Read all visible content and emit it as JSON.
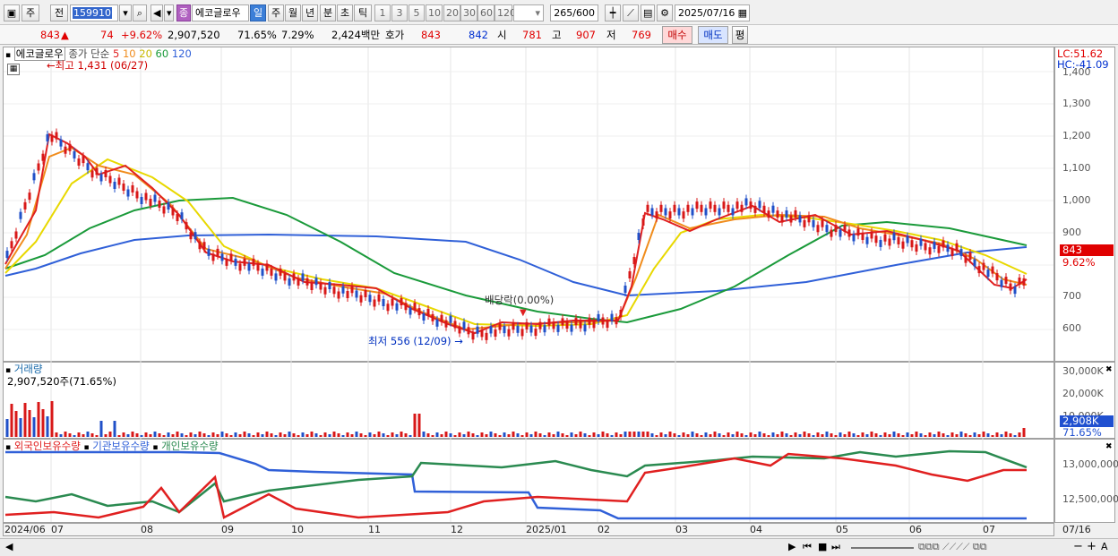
{
  "toolbar": {
    "period_label": "주",
    "prev_label": "전",
    "code": "159910",
    "stock_badge": "종",
    "stock_name": "에코글로우",
    "periods": [
      "일",
      "주",
      "월",
      "년",
      "분",
      "초",
      "틱"
    ],
    "selected_period": "일",
    "intervals": [
      "1",
      "3",
      "5",
      "10",
      "20",
      "30",
      "60",
      "120"
    ],
    "count_value": "265",
    "count_total": "/600",
    "date": "2025/07/16"
  },
  "quote": {
    "price": "843",
    "change": "74",
    "change_pct": "+9.62%",
    "volume": "2,907,520",
    "volume_ratio": "71.65%",
    "turnover": "7.29%",
    "amount": "2,424백만",
    "quote_label": "호가",
    "ask": "843",
    "bid": "842",
    "open_label": "시",
    "open": "781",
    "high_label": "고",
    "high": "907",
    "low_label": "저",
    "low": "769",
    "buy_label": "매수",
    "sell_label": "매도",
    "avg_label": "평"
  },
  "price_pane": {
    "legend_name": "에코글로우",
    "legend_ma_label": "종가 단순",
    "ma_periods": [
      {
        "label": "5",
        "color": "#e02020"
      },
      {
        "label": "10",
        "color": "#f08c1c"
      },
      {
        "label": "20",
        "color": "#e8d800"
      },
      {
        "label": "60",
        "color": "#1a9a3a"
      },
      {
        "label": "120",
        "color": "#3060d8"
      }
    ],
    "high_note": "최고 1,431 (06/27)",
    "low_note": "최저 556 (12/09)",
    "dividend_note": "배당락(0.00%)",
    "lc": "LC:51.62",
    "hc": "HC:-41.09",
    "yticks": [
      "1,400",
      "1,300",
      "1,200",
      "1,100",
      "1,000",
      "900",
      "800",
      "700",
      "600"
    ],
    "price_tag": "843",
    "pct_tag": "9.62%"
  },
  "volume_pane": {
    "title": "거래량",
    "value": "2,907,520주(71.65%)",
    "yticks": [
      "30,000K",
      "20,000K",
      "10,000K"
    ],
    "value_tag": "2,908K",
    "pct_tag": "71.65%"
  },
  "holding_pane": {
    "legend": [
      {
        "label": "외국인보유수량",
        "color": "#e02020"
      },
      {
        "label": "기관보유수량",
        "color": "#3060d8"
      },
      {
        "label": "개인보유수량",
        "color": "#2a8a50"
      }
    ],
    "yticks": [
      "13,000,000",
      "12,500,000"
    ]
  },
  "xaxis": {
    "labels": [
      "2024/06",
      "07",
      "08",
      "09",
      "10",
      "11",
      "12",
      "2025/01",
      "02",
      "03",
      "04",
      "05",
      "06",
      "07"
    ],
    "end_label": "07/16"
  }
}
